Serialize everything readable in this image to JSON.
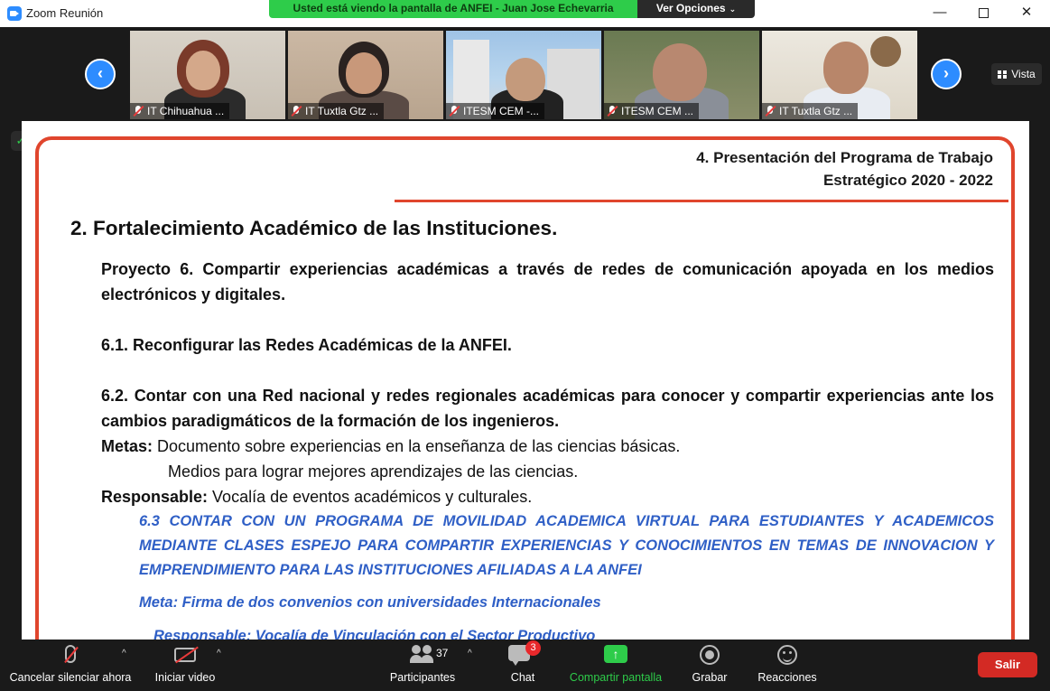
{
  "window": {
    "title": "Zoom Reunión",
    "sharing_banner": "Usted está viendo la pantalla de ANFEI - Juan Jose Echevarria",
    "view_options": "Ver Opciones",
    "controls": {
      "minimize": "—",
      "close": "✕"
    }
  },
  "video_strip": {
    "prev": "‹",
    "next": "›",
    "view_label": "Vista",
    "participants": [
      {
        "name": "IT Chihuahua ..."
      },
      {
        "name": "IT Tuxtla Gtz ..."
      },
      {
        "name": "ITESM CEM -..."
      },
      {
        "name": "ITESM CEM ..."
      },
      {
        "name": "IT Tuxtla Gtz ..."
      }
    ]
  },
  "slide": {
    "header_line1": "4. Presentación del Programa de Trabajo",
    "header_line2": "Estratégico 2020 - 2022",
    "heading": "2. Fortalecimiento Académico de las Instituciones.",
    "proyecto": "Proyecto 6. Compartir experiencias académicas a través de redes de comunicación apoyada en los medios electrónicos y digitales.",
    "item_61": "6.1. Reconfigurar las Redes Académicas de la ANFEI.",
    "item_62": "6.2. Contar con una Red nacional y redes regionales académicas para conocer y compartir experiencias ante los cambios paradigmáticos de la formación de los ingenieros.",
    "metas_label": "Metas:",
    "metas_1": "Documento sobre experiencias en la enseñanza de las ciencias básicas.",
    "metas_2": "Medios para lograr mejores aprendizajes de las ciencias.",
    "responsable_label": "Responsable:",
    "responsable_value": "Vocalía de eventos académicos y culturales.",
    "item_63": "6.3 CONTAR CON UN PROGRAMA DE MOVILIDAD ACADEMICA VIRTUAL PARA ESTUDIANTES Y ACADEMICOS MEDIANTE CLASES ESPEJO PARA COMPARTIR EXPERIENCIAS Y CONOCIMIENTOS EN TEMAS DE INNOVACION Y EMPRENDIMIENTO PARA LAS INSTITUCIONES AFILIADAS A LA ANFEI",
    "meta_63": "Meta: Firma de dos convenios con universidades Internacionales",
    "responsable_63": "Responsable: Vocalía de Vinculación con el Sector Productivo"
  },
  "toolbar": {
    "mute_label": "Cancelar silenciar ahora",
    "video_label": "Iniciar video",
    "participants_label": "Participantes",
    "participants_count": "37",
    "chat_label": "Chat",
    "chat_badge": "3",
    "share_label": "Compartir pantalla",
    "share_arrow": "↑",
    "record_label": "Grabar",
    "reactions_label": "Reacciones",
    "leave_label": "Salir",
    "caret": "^"
  }
}
